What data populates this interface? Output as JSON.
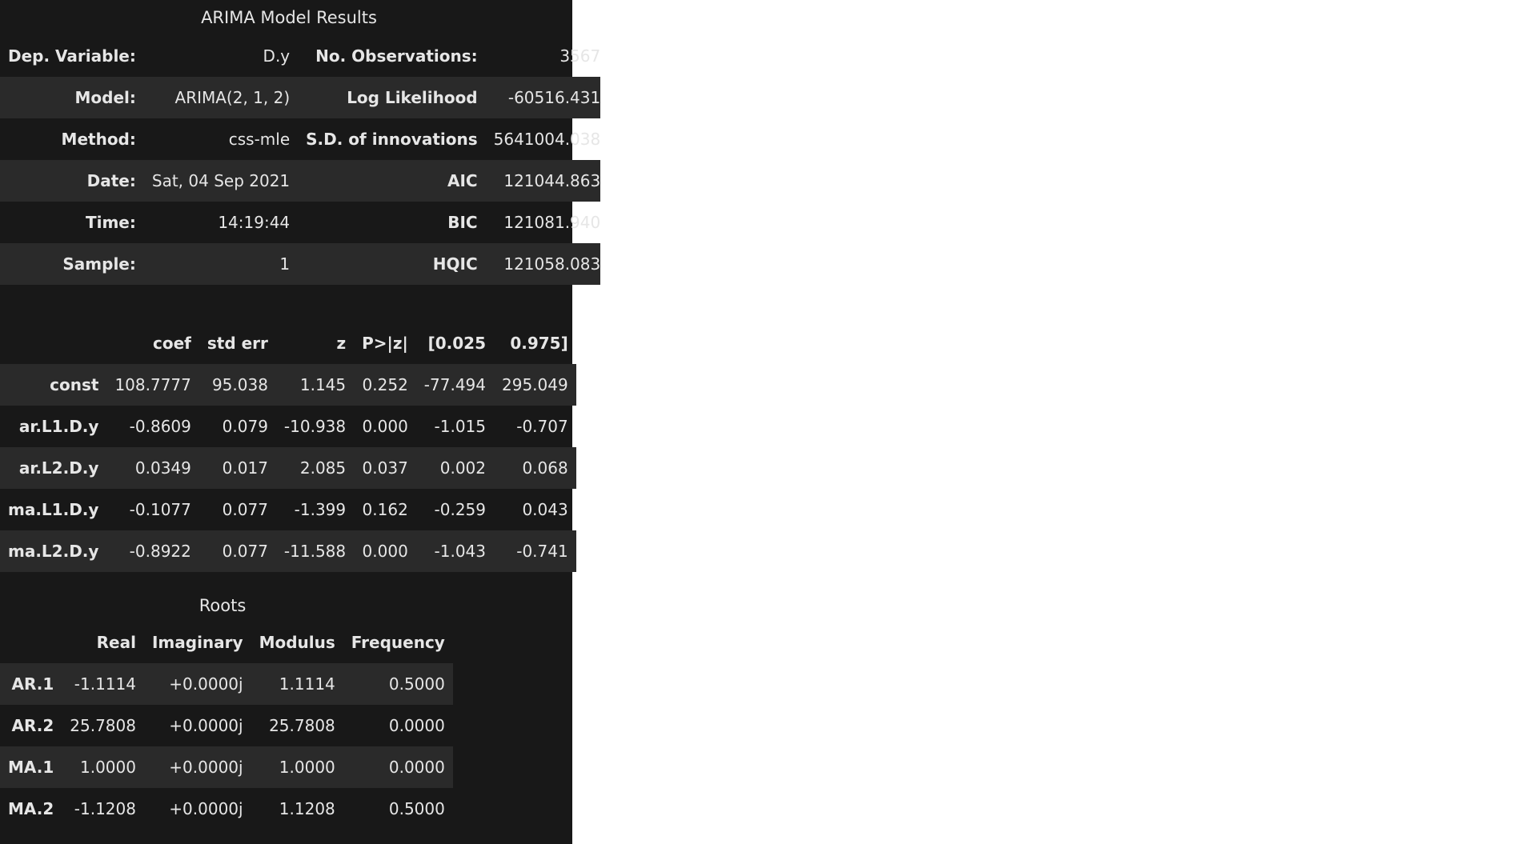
{
  "summary": {
    "title": "ARIMA Model Results",
    "rows": [
      {
        "l1": "Dep. Variable:",
        "v1": "D.y",
        "l2": "No. Observations:",
        "v2": "3567"
      },
      {
        "l1": "Model:",
        "v1": "ARIMA(2, 1, 2)",
        "l2": "Log Likelihood",
        "v2": "-60516.431"
      },
      {
        "l1": "Method:",
        "v1": "css-mle",
        "l2": "S.D. of innovations",
        "v2": "5641004.038"
      },
      {
        "l1": "Date:",
        "v1": "Sat, 04 Sep 2021",
        "l2": "AIC",
        "v2": "121044.863"
      },
      {
        "l1": "Time:",
        "v1": "14:19:44",
        "l2": "BIC",
        "v2": "121081.940"
      },
      {
        "l1": "Sample:",
        "v1": "1",
        "l2": "HQIC",
        "v2": "121058.083"
      }
    ]
  },
  "coef": {
    "headers": [
      "coef",
      "std err",
      "z",
      "P>|z|",
      "[0.025",
      "0.975]"
    ],
    "rows": [
      {
        "name": "const",
        "vals": [
          "108.7777",
          "95.038",
          "1.145",
          "0.252",
          "-77.494",
          "295.049"
        ]
      },
      {
        "name": "ar.L1.D.y",
        "vals": [
          "-0.8609",
          "0.079",
          "-10.938",
          "0.000",
          "-1.015",
          "-0.707"
        ]
      },
      {
        "name": "ar.L2.D.y",
        "vals": [
          "0.0349",
          "0.017",
          "2.085",
          "0.037",
          "0.002",
          "0.068"
        ]
      },
      {
        "name": "ma.L1.D.y",
        "vals": [
          "-0.1077",
          "0.077",
          "-1.399",
          "0.162",
          "-0.259",
          "0.043"
        ]
      },
      {
        "name": "ma.L2.D.y",
        "vals": [
          "-0.8922",
          "0.077",
          "-11.588",
          "0.000",
          "-1.043",
          "-0.741"
        ]
      }
    ]
  },
  "roots": {
    "title": "Roots",
    "headers": [
      "Real",
      "Imaginary",
      "Modulus",
      "Frequency"
    ],
    "rows": [
      {
        "name": "AR.1",
        "vals": [
          "-1.1114",
          "+0.0000j",
          "1.1114",
          "0.5000"
        ]
      },
      {
        "name": "AR.2",
        "vals": [
          "25.7808",
          "+0.0000j",
          "25.7808",
          "0.0000"
        ]
      },
      {
        "name": "MA.1",
        "vals": [
          "1.0000",
          "+0.0000j",
          "1.0000",
          "0.0000"
        ]
      },
      {
        "name": "MA.2",
        "vals": [
          "-1.1208",
          "+0.0000j",
          "1.1208",
          "0.5000"
        ]
      }
    ]
  }
}
